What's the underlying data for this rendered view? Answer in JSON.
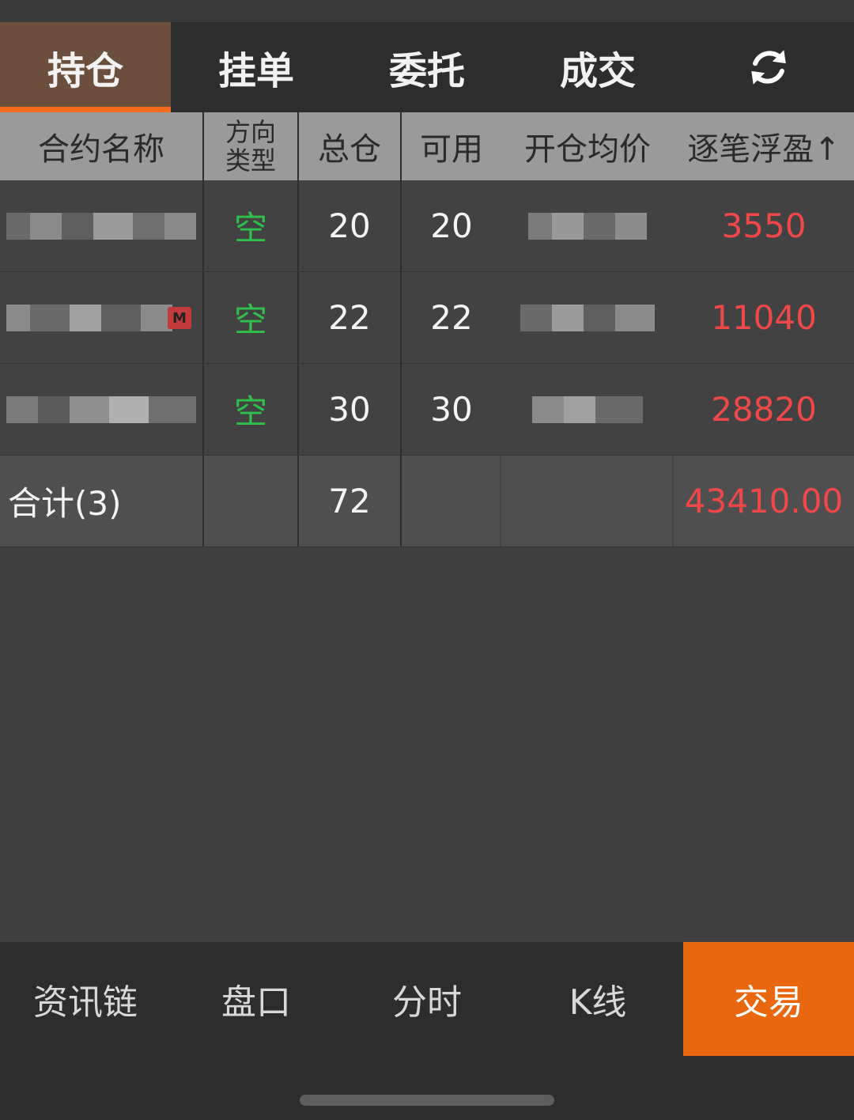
{
  "tabs": [
    {
      "label": "持仓"
    },
    {
      "label": "挂单"
    },
    {
      "label": "委托"
    },
    {
      "label": "成交"
    }
  ],
  "table": {
    "headers": {
      "name": "合约名称",
      "direction_line1": "方向",
      "direction_line2": "类型",
      "total": "总仓",
      "available": "可用",
      "avg_price": "开仓均价",
      "pnl": "逐笔浮盈↑"
    },
    "rows": [
      {
        "direction": "空",
        "total": "20",
        "available": "20",
        "pnl": "3550"
      },
      {
        "direction": "空",
        "total": "22",
        "available": "22",
        "pnl": "11040"
      },
      {
        "direction": "空",
        "total": "30",
        "available": "30",
        "pnl": "28820"
      }
    ],
    "total": {
      "label": "合计(3)",
      "total": "72",
      "pnl": "43410.00"
    }
  },
  "bottom_tabs": [
    {
      "label": "资讯链"
    },
    {
      "label": "盘口"
    },
    {
      "label": "分时"
    },
    {
      "label": "K线"
    },
    {
      "label": "交易"
    }
  ],
  "colors": {
    "accent": "#e8670f",
    "short": "#2fbf4a",
    "profit": "#f04848"
  },
  "icons": {
    "refresh": "refresh-icon"
  }
}
